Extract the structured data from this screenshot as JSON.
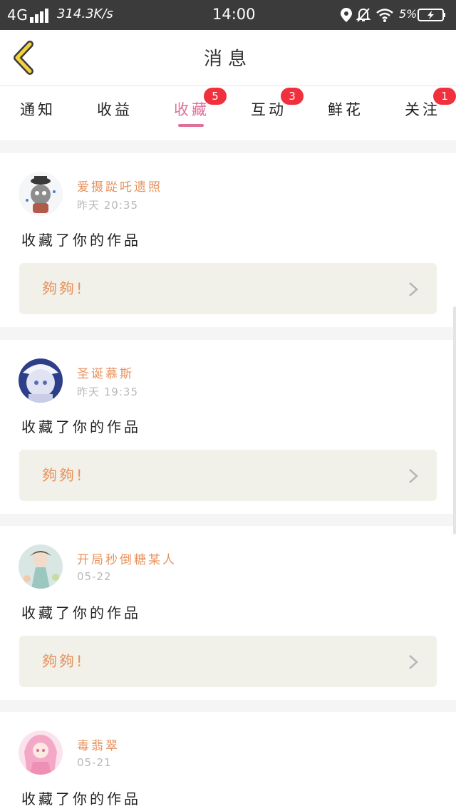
{
  "status": {
    "network": "4G",
    "speed": "314.3K/s",
    "time": "14:00",
    "battery": "5%"
  },
  "header": {
    "title": "消息"
  },
  "tabs": [
    {
      "label": "通知",
      "badge": ""
    },
    {
      "label": "收益",
      "badge": ""
    },
    {
      "label": "收藏",
      "badge": "5"
    },
    {
      "label": "互动",
      "badge": "3"
    },
    {
      "label": "鲜花",
      "badge": ""
    },
    {
      "label": "关注",
      "badge": "1"
    }
  ],
  "active_tab": "收藏",
  "colors": {
    "accent": "#e0709a",
    "name": "#e8925e",
    "badge": "#f0303c",
    "work_bg": "#f1f1e9"
  },
  "messages": [
    {
      "name": "爱摄踨吒遗照",
      "time": "昨天 20:35",
      "text": "收藏了你的作品",
      "work": "夠夠!"
    },
    {
      "name": "圣诞慕斯",
      "time": "昨天 19:35",
      "text": "收藏了你的作品",
      "work": "夠夠!"
    },
    {
      "name": "开局秒倒糖某人",
      "time": "05-22",
      "text": "收藏了你的作品",
      "work": "夠夠!"
    },
    {
      "name": "毒翡翠",
      "time": "05-21",
      "text": "收藏了你的作品",
      "work": ""
    }
  ]
}
